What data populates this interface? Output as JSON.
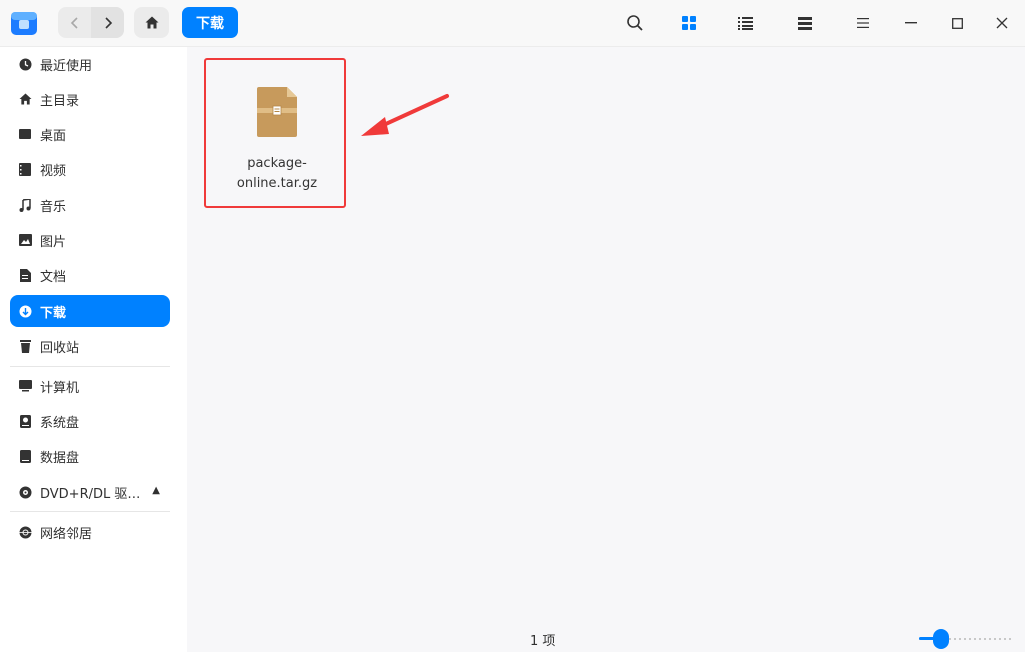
{
  "titlebar": {
    "breadcrumb": "下载",
    "icons": [
      "back-icon",
      "forward-icon",
      "home-icon",
      "search-icon",
      "icon-view-icon",
      "list-view-icon",
      "detail-view-icon",
      "menu-icon",
      "minimize-icon",
      "maximize-icon",
      "close-icon"
    ]
  },
  "sidebar": {
    "items": [
      {
        "label": "最近使用",
        "icon": "clock-icon"
      },
      {
        "label": "主目录",
        "icon": "home-icon"
      },
      {
        "label": "桌面",
        "icon": "desktop-icon"
      },
      {
        "label": "视频",
        "icon": "video-icon"
      },
      {
        "label": "音乐",
        "icon": "music-icon"
      },
      {
        "label": "图片",
        "icon": "picture-icon"
      },
      {
        "label": "文档",
        "icon": "document-icon"
      },
      {
        "label": "下载",
        "icon": "download-icon",
        "active": true
      },
      {
        "label": "回收站",
        "icon": "trash-icon"
      }
    ],
    "devices": [
      {
        "label": "计算机",
        "icon": "computer-icon"
      },
      {
        "label": "系统盘",
        "icon": "disk-icon"
      },
      {
        "label": "数据盘",
        "icon": "disk-icon"
      },
      {
        "label": "DVD+R/DL 驱…",
        "icon": "dvd-icon"
      }
    ],
    "network": [
      {
        "label": "网络邻居",
        "icon": "network-icon"
      }
    ]
  },
  "main": {
    "file": {
      "name": "package-online.tar.gz",
      "name_line1": "package-",
      "name_line2": "online.tar.gz"
    },
    "status": "1 项",
    "zoom_level": 0.15
  },
  "colors": {
    "accent": "#0081ff",
    "highlight": "#f03a3a"
  }
}
